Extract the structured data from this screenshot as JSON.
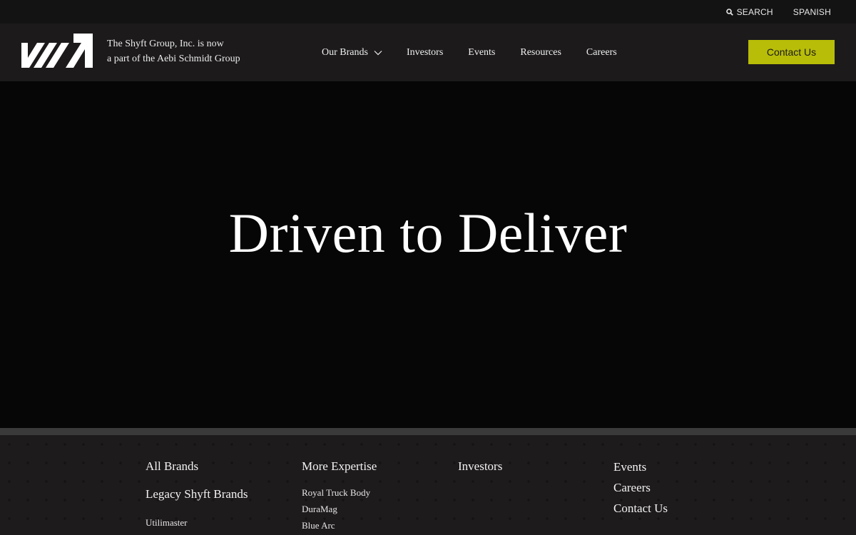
{
  "utility": {
    "search_label": "SEARCH",
    "language_label": "SPANISH",
    "search_icon": "search-icon"
  },
  "header": {
    "tagline_line1": "The Shyft Group, Inc. is now",
    "tagline_line2": "a part of the Aebi Schmidt Group",
    "nav": {
      "brands": "Our Brands",
      "investors": "Investors",
      "events": "Events",
      "resources": "Resources",
      "careers": "Careers"
    },
    "contact_label": "Contact Us",
    "contact_color": "#b8bd08"
  },
  "hero": {
    "title": "Driven to Deliver"
  },
  "footer": {
    "col1": {
      "all_brands": "All Brands",
      "legacy": "Legacy Shyft Brands",
      "items": [
        "Utilimaster"
      ]
    },
    "col2": {
      "heading": "More Expertise",
      "items": [
        "Royal Truck Body",
        "DuraMag",
        "Blue Arc"
      ]
    },
    "col3": {
      "heading": "Investors"
    },
    "col4": {
      "items": [
        "Events",
        "Careers",
        "Contact Us"
      ]
    }
  }
}
